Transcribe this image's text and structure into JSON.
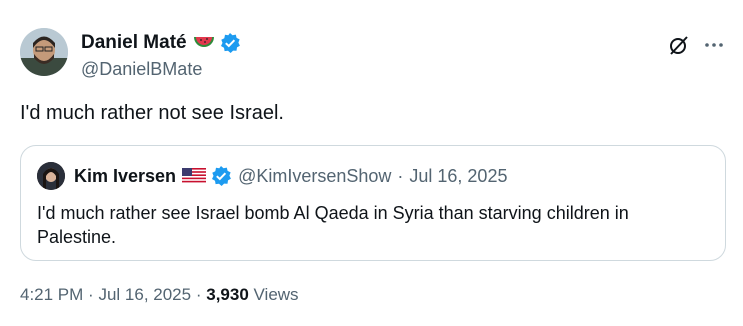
{
  "post": {
    "author": {
      "display_name": "Daniel Maté",
      "emoji_icon": "watermelon-icon",
      "verified": true,
      "handle": "@DanielBMate"
    },
    "text": "I'd much rather not see Israel.",
    "actions": {
      "grok_icon": "grok-icon",
      "more_icon": "more-icon"
    }
  },
  "quote": {
    "author": {
      "display_name": "Kim Iversen",
      "flag_icon": "us-flag-icon",
      "verified": true,
      "handle": "@KimIversenShow"
    },
    "separator": "·",
    "date": "Jul 16, 2025",
    "text": "I'd much rather see Israel bomb Al Qaeda in Syria than starving children in Palestine."
  },
  "footer": {
    "time": "4:21 PM",
    "separator": "·",
    "date": "Jul 16, 2025",
    "views_count": "3,930",
    "views_label": "Views"
  },
  "colors": {
    "text": "#0f1419",
    "secondary": "#536471",
    "verified": "#1d9bf0",
    "border": "#cfd9de"
  }
}
